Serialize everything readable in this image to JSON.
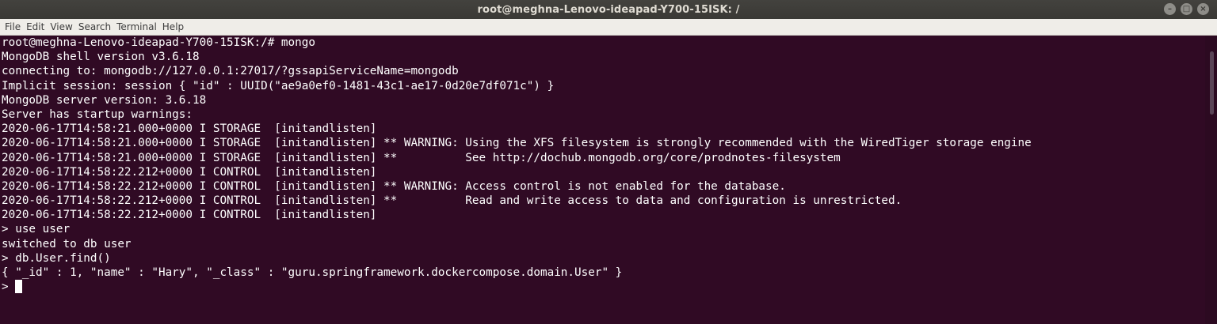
{
  "window": {
    "title": "root@meghna-Lenovo-ideapad-Y700-15ISK: /",
    "controls": {
      "minimize": "–",
      "maximize": "□",
      "close": "×"
    }
  },
  "menu": {
    "items": [
      "File",
      "Edit",
      "View",
      "Search",
      "Terminal",
      "Help"
    ]
  },
  "terminal": {
    "lines": [
      "root@meghna-Lenovo-ideapad-Y700-15ISK:/# mongo",
      "MongoDB shell version v3.6.18",
      "connecting to: mongodb://127.0.0.1:27017/?gssapiServiceName=mongodb",
      "Implicit session: session { \"id\" : UUID(\"ae9a0ef0-1481-43c1-ae17-0d20e7df071c\") }",
      "MongoDB server version: 3.6.18",
      "Server has startup warnings:",
      "2020-06-17T14:58:21.000+0000 I STORAGE  [initandlisten]",
      "2020-06-17T14:58:21.000+0000 I STORAGE  [initandlisten] ** WARNING: Using the XFS filesystem is strongly recommended with the WiredTiger storage engine",
      "2020-06-17T14:58:21.000+0000 I STORAGE  [initandlisten] **          See http://dochub.mongodb.org/core/prodnotes-filesystem",
      "2020-06-17T14:58:22.212+0000 I CONTROL  [initandlisten]",
      "2020-06-17T14:58:22.212+0000 I CONTROL  [initandlisten] ** WARNING: Access control is not enabled for the database.",
      "2020-06-17T14:58:22.212+0000 I CONTROL  [initandlisten] **          Read and write access to data and configuration is unrestricted.",
      "2020-06-17T14:58:22.212+0000 I CONTROL  [initandlisten]",
      "> use user",
      "switched to db user",
      "> db.User.find()",
      "{ \"_id\" : 1, \"name\" : \"Hary\", \"_class\" : \"guru.springframework.dockercompose.domain.User\" }"
    ],
    "prompt": ">"
  },
  "colors": {
    "background": "#300a24",
    "text": "#ffffff",
    "titlebar": "#3c3b37",
    "menubar": "#efede8"
  }
}
